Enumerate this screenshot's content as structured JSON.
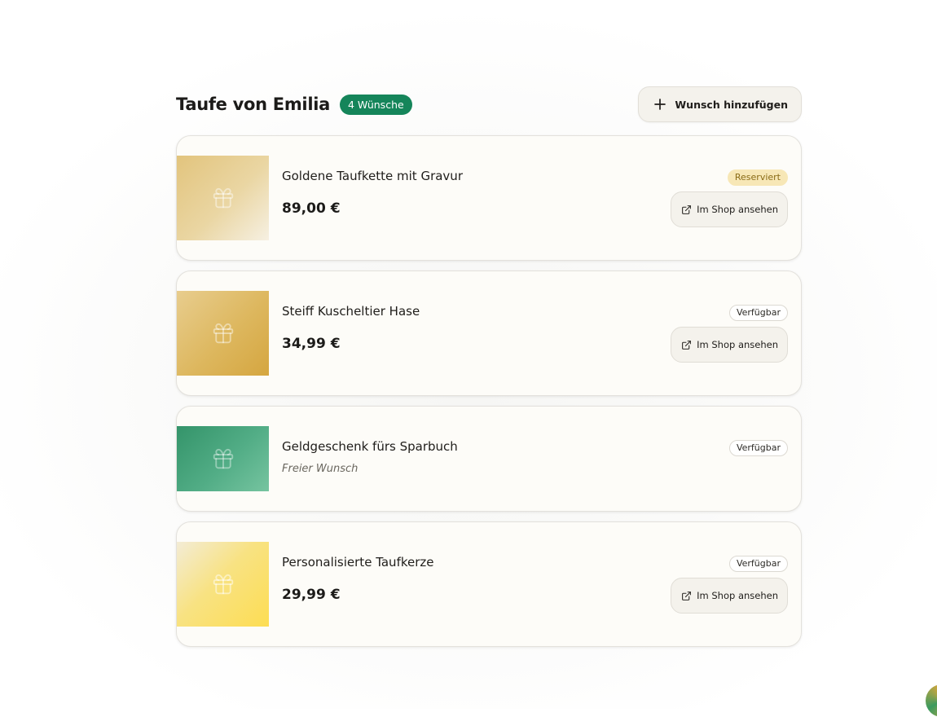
{
  "page": {
    "title": "Taufe von Emilia",
    "count_badge": "4 Wünsche",
    "add_button_label": "Wunsch hinzufügen"
  },
  "colors": {
    "accent_green": "#15855a",
    "reserved_badge_bg": "#f7e7b6",
    "reserved_badge_text": "#8a6b16"
  },
  "wishes": [
    {
      "name": "Goldene Taufkette mit Gravur",
      "price": "89,00 €",
      "status": "Reserviert",
      "shop_button": "Im Shop ansehen",
      "icon": "gift-icon"
    },
    {
      "name": "Steiff Kuscheltier Hase",
      "price": "34,99 €",
      "status": "Verfügbar",
      "shop_button": "Im Shop ansehen",
      "icon": "gift-icon"
    },
    {
      "name": "Geldgeschenk fürs Sparbuch",
      "note": "Freier Wunsch",
      "status": "Verfügbar",
      "icon": "gift-icon"
    },
    {
      "name": "Personalisierte Taufkerze",
      "price": "29,99 €",
      "status": "Verfügbar",
      "shop_button": "Im Shop ansehen",
      "icon": "gift-icon"
    }
  ]
}
